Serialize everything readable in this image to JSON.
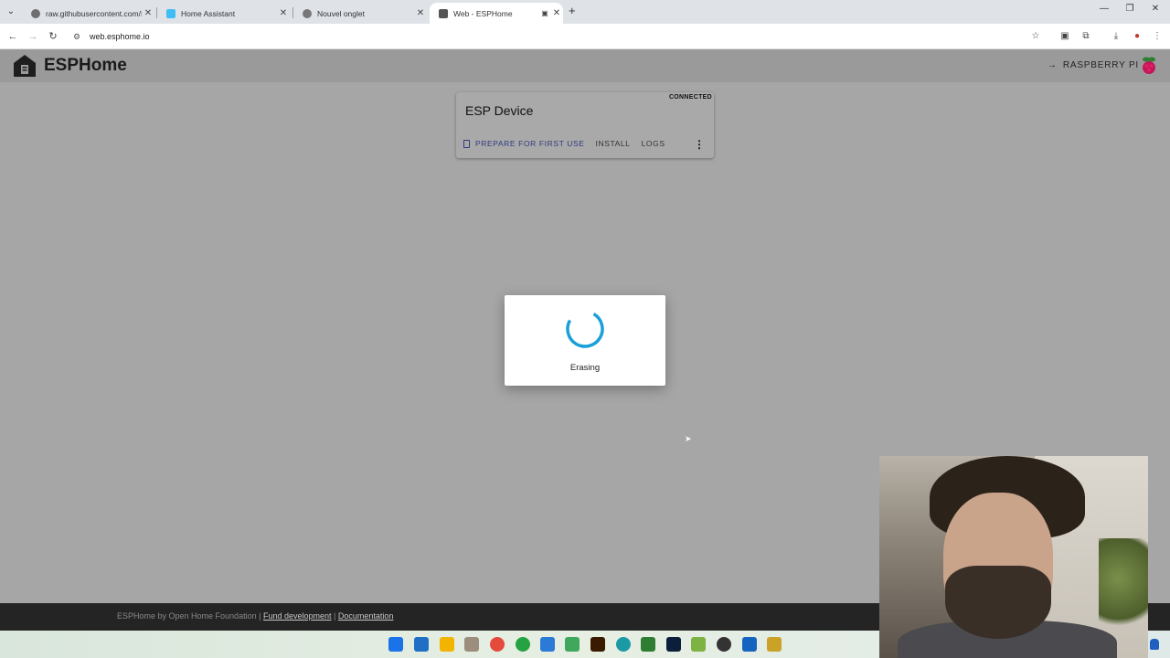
{
  "browser": {
    "tabs": [
      {
        "title": "raw.githubusercontent.com/RA",
        "active": false
      },
      {
        "title": "Home Assistant",
        "active": false
      },
      {
        "title": "Nouvel onglet",
        "active": false
      },
      {
        "title": "Web - ESPHome",
        "active": true
      }
    ],
    "url": "web.esphome.io"
  },
  "header": {
    "logo_text": "ESPHome",
    "link_label": "RASPBERRY PI"
  },
  "device": {
    "status": "CONNECTED",
    "name": "ESP Device",
    "actions": {
      "prepare": "PREPARE FOR FIRST USE",
      "install": "INSTALL",
      "logs": "LOGS"
    }
  },
  "dialog": {
    "status_text": "Erasing"
  },
  "footer": {
    "prefix": "ESPHome by Open Home Foundation",
    "separator": "|",
    "fund_link": "Fund development",
    "docs_link": "Documentation"
  },
  "colors": {
    "accent": "#303a80",
    "spinner": "#1aa0d8",
    "page_bg": "#a6a6a6"
  },
  "taskbar_icons": [
    "start-icon",
    "vscode-icon",
    "file-explorer-icon",
    "archive-icon",
    "chrome-icon",
    "whatsapp-icon",
    "paint-icon",
    "app-green-icon",
    "illustrator-icon",
    "arduino-icon",
    "terminal-icon",
    "photoshop-icon",
    "android-icon",
    "app-ball-icon",
    "visio-icon",
    "notes-icon"
  ]
}
